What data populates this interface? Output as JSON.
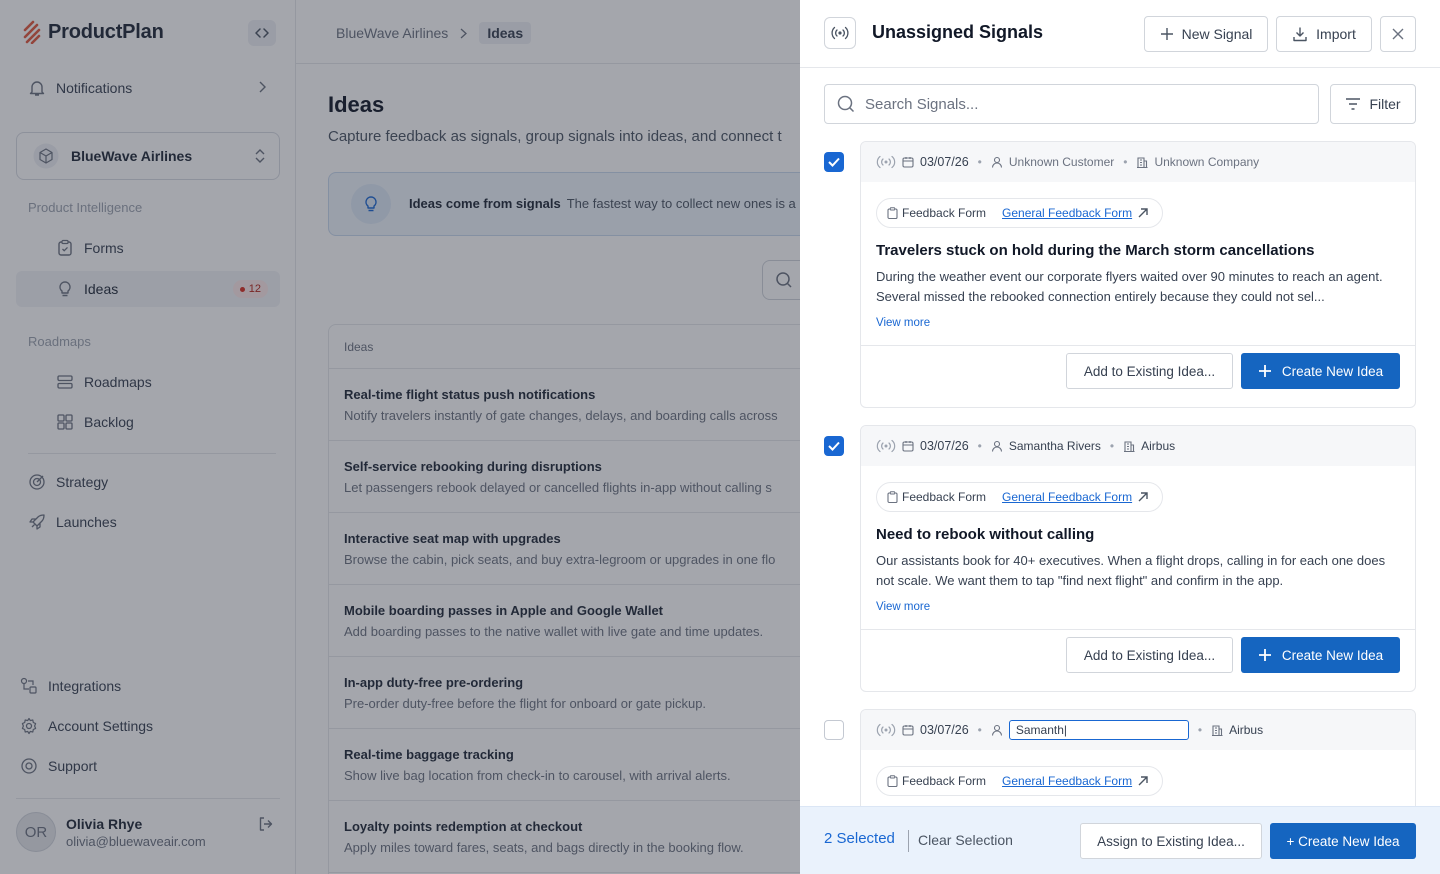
{
  "app": {
    "name": "ProductPlan"
  },
  "sidebar": {
    "notifications_label": "Notifications",
    "workspace": "BlueWave Airlines",
    "section_product_intelligence": "Product Intelligence",
    "forms_label": "Forms",
    "ideas_label": "Ideas",
    "ideas_count": "12",
    "section_roadmaps": "Roadmaps",
    "roadmaps_label": "Roadmaps",
    "backlog_label": "Backlog",
    "strategy_label": "Strategy",
    "launches_label": "Launches",
    "integrations_label": "Integrations",
    "account_settings_label": "Account Settings",
    "support_label": "Support",
    "user": {
      "initials": "OR",
      "name": "Olivia Rhye",
      "email": "olivia@bluewaveair.com"
    }
  },
  "main": {
    "breadcrumb": {
      "root": "BlueWave Airlines",
      "current": "Ideas"
    },
    "title": "Ideas",
    "subtitle": "Capture feedback as signals, group signals into ideas, and connect t",
    "banner": {
      "title": "Ideas come from signals",
      "text": "The fastest way to collect new ones is a"
    },
    "table": {
      "header": "Ideas",
      "rows": [
        {
          "title": "Real-time flight status push notifications",
          "desc": "Notify travelers instantly of gate changes, delays, and boarding calls across"
        },
        {
          "title": "Self-service rebooking during disruptions",
          "desc": "Let passengers rebook delayed or cancelled flights in-app without calling s"
        },
        {
          "title": "Interactive seat map with upgrades",
          "desc": "Browse the cabin, pick seats, and buy extra-legroom or upgrades in one flo"
        },
        {
          "title": "Mobile boarding passes in Apple and Google Wallet",
          "desc": "Add boarding passes to the native wallet with live gate and time updates."
        },
        {
          "title": "In-app duty-free pre-ordering",
          "desc": "Pre-order duty-free before the flight for onboard or gate pickup."
        },
        {
          "title": "Real-time baggage tracking",
          "desc": "Show live bag location from check-in to carousel, with arrival alerts."
        },
        {
          "title": "Loyalty points redemption at checkout",
          "desc": "Apply miles toward fares, seats, and bags directly in the booking flow."
        }
      ]
    }
  },
  "drawer": {
    "title": "Unassigned Signals",
    "new_signal_label": "New Signal",
    "import_label": "Import",
    "search_placeholder": "Search Signals...",
    "filter_label": "Filter",
    "signals": [
      {
        "checked": true,
        "date": "03/07/26",
        "customer": "Unknown Customer",
        "company": "Unknown Company",
        "source_type": "Feedback Form",
        "source_link": "General Feedback Form",
        "title": "Travelers stuck on hold during the March storm cancellations",
        "desc": "During the weather event our corporate flyers waited over 90 minutes to reach an agent. Several missed the rebooked connection entirely because they could not sel...",
        "view_more": "View more",
        "add_label": "Add to Existing Idea...",
        "create_label": "Create New Idea"
      },
      {
        "checked": true,
        "date": "03/07/26",
        "customer": "Samantha Rivers",
        "company": "Airbus",
        "source_type": "Feedback Form",
        "source_link": "General Feedback Form",
        "title": "Need to rebook without calling",
        "desc": "Our assistants book for 40+ executives. When a flight drops, calling in for each one does not scale. We want them to tap \"find next flight\" and confirm in the app.",
        "view_more": "View more",
        "add_label": "Add to Existing Idea...",
        "create_label": "Create New Idea"
      },
      {
        "checked": false,
        "date": "03/07/26",
        "customer_input_value": "Samanth|",
        "company": "Airbus",
        "source_type": "Feedback Form",
        "source_link": "General Feedback Form"
      }
    ],
    "footer": {
      "selected_label": "2 Selected",
      "clear_label": "Clear Selection",
      "assign_label": "Assign to Existing Idea...",
      "create_label": "+ Create New Idea"
    }
  },
  "colors": {
    "accent": "#1565c0",
    "link": "#1967d2",
    "badge_red": "#d92d20",
    "footer_bg": "#eaf2fc"
  }
}
